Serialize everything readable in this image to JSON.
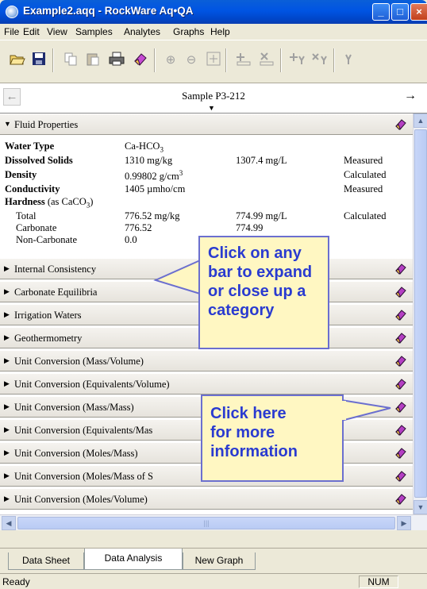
{
  "window": {
    "title": "Example2.aqq - RockWare Aq•QA"
  },
  "menu": [
    "File",
    "Edit",
    "View",
    "Samples",
    "Analytes",
    "Graphs",
    "Help"
  ],
  "toolbar": [
    "open-icon",
    "save-icon",
    "copy-icon",
    "paste-icon",
    "print-icon",
    "eraser-icon",
    "zoom-in-icon",
    "zoom-out-icon",
    "fit-icon",
    "add-row-icon",
    "delete-row-icon",
    "add-analyte-icon",
    "delete-analyte-icon"
  ],
  "nav": {
    "sample": "Sample P3-212"
  },
  "fluid": {
    "header": "Fluid Properties",
    "water_type_label": "Water Type",
    "water_type_value": "Ca-HCO",
    "water_type_sub": "3",
    "dissolved_label": "Dissolved Solids",
    "dissolved_mgkg": "1310 mg/kg",
    "dissolved_mgl": "1307.4 mg/L",
    "dissolved_status": "Measured",
    "density_label": "Density",
    "density_value": "0.99802 g/cm",
    "density_sup": "3",
    "density_status": "Calculated",
    "conductivity_label": "Conductivity",
    "conductivity_value": "1405 µmho/cm",
    "conductivity_status": "Measured",
    "hardness_label": "Hardness",
    "hardness_suffix": "(as CaCO",
    "hardness_sub": "3",
    "hardness_close": ")",
    "total_label": "Total",
    "total_mgkg": "776.52 mg/kg",
    "total_mgl": "774.99 mg/L",
    "total_status": "Calculated",
    "carbonate_label": "Carbonate",
    "carbonate_mgkg": "776.52",
    "carbonate_mgl": "774.99",
    "noncarb_label": "Non-Carbonate",
    "noncarb_mgkg": "0.0"
  },
  "categories": [
    "Internal Consistency",
    "Carbonate Equilibria",
    "Irrigation Waters",
    "Geothermometry",
    "Unit Conversion (Mass/Volume)",
    "Unit Conversion (Equivalents/Volume)",
    "Unit Conversion (Mass/Mass)",
    "Unit Conversion (Equivalents/Mas",
    "Unit Conversion (Moles/Mass)",
    "Unit Conversion (Moles/Mass of S",
    "Unit Conversion (Moles/Volume)"
  ],
  "callouts": {
    "expand": [
      "Click on any",
      "bar to expand",
      "or close up a",
      "category"
    ],
    "info": [
      "Click here",
      "for more",
      "information"
    ]
  },
  "tabs": [
    "Data Sheet",
    "Data Analysis",
    "New Graph"
  ],
  "status": {
    "text": "Ready",
    "num": "NUM"
  },
  "colors": {
    "titlebar": "#0054e3",
    "callout_fill": "#fff7c2",
    "callout_text": "#2a3bd0",
    "callout_border": "#6b6fcf"
  }
}
